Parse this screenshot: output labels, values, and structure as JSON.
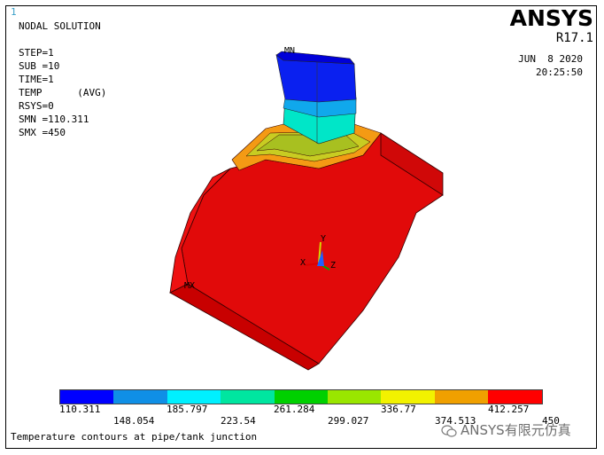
{
  "window_number": "1",
  "solution_info": {
    "title": "NODAL SOLUTION",
    "lines": [
      "STEP=1",
      "SUB =10",
      "TIME=1",
      "TEMP      (AVG)",
      "RSYS=0",
      "SMN =110.311",
      "SMX =450"
    ]
  },
  "brand": {
    "name": "ANSYS",
    "version": "R17.1"
  },
  "date": "JUN  8 2020",
  "time": "20:25:50",
  "markers": {
    "min": "MN",
    "max": "MX"
  },
  "triad": {
    "x": "X",
    "y": "Y",
    "z": "Z"
  },
  "legend": {
    "colors": [
      "#0000ff",
      "#0f8fe6",
      "#00f0ff",
      "#00e6a0",
      "#00d000",
      "#9ae600",
      "#f2f200",
      "#f0a000",
      "#ff0000"
    ],
    "values_top": [
      "110.311",
      "185.797",
      "261.284",
      "336.77",
      "412.257"
    ],
    "values_bottom": [
      "148.054",
      "223.54",
      "299.027",
      "374.513",
      "450"
    ]
  },
  "caption": "Temperature contours at pipe/tank junction",
  "watermark": "ANSYS有限元仿真"
}
